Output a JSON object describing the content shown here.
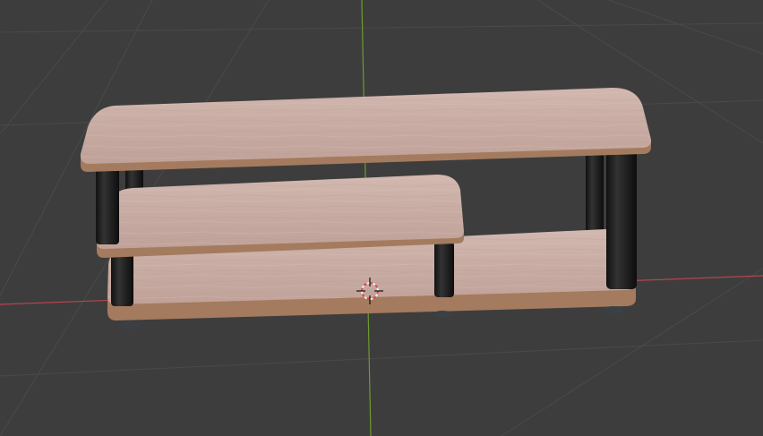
{
  "viewport": {
    "view": "perspective",
    "background_color": "#3d3d3d",
    "grid_color": "#4a4a4a",
    "x_axis_color": "#b8434f",
    "y_axis_color": "#6e9a2f",
    "cursor_icon": "3d-cursor-icon"
  },
  "object": {
    "type": "tv-stand-shelf",
    "wood_color": "#cfb2aa",
    "wood_edge_color": "#a47b5e",
    "leg_color": "#1c1c1c",
    "foot_color": "#3a4046"
  }
}
